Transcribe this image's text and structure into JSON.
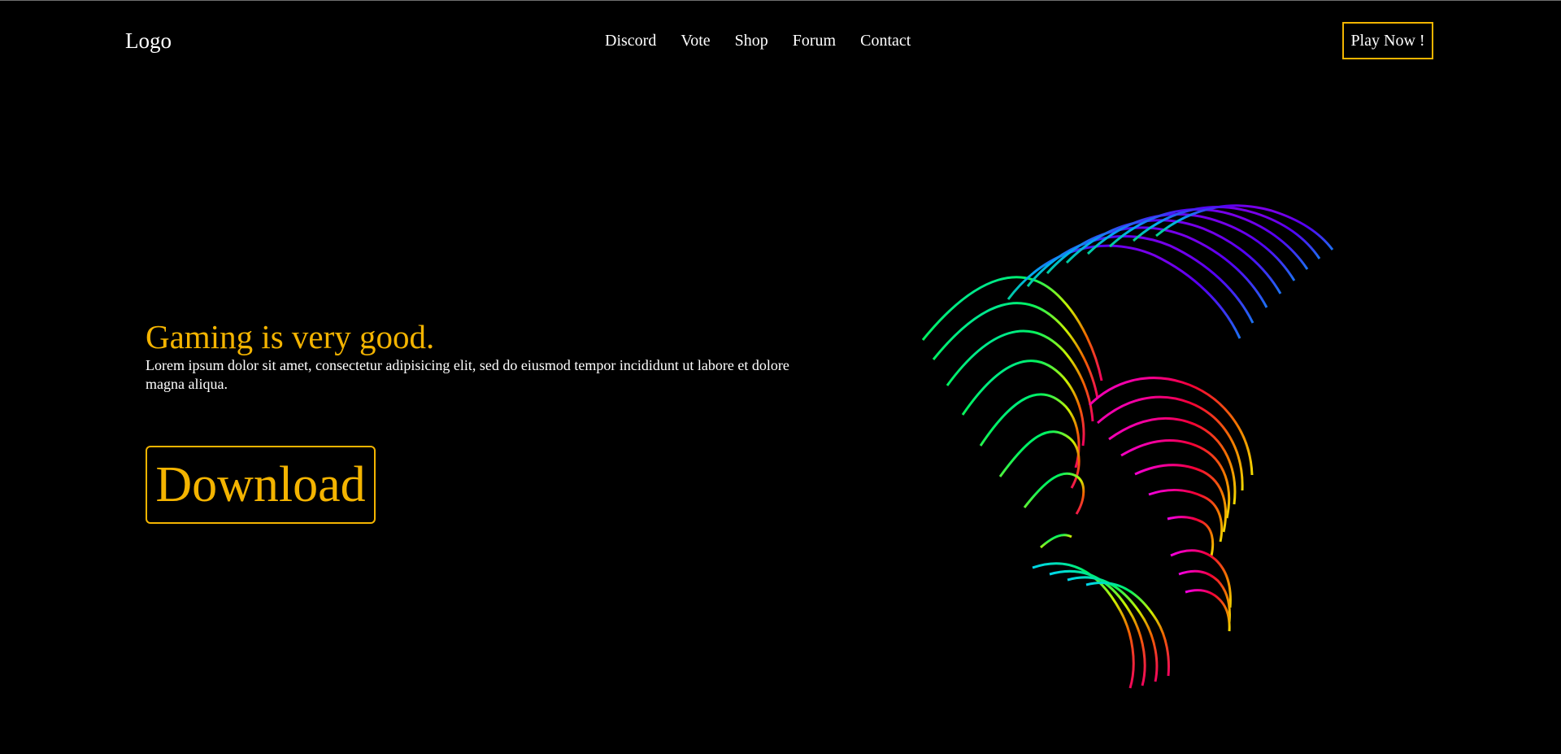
{
  "header": {
    "logo": "Logo",
    "nav": [
      "Discord",
      "Vote",
      "Shop",
      "Forum",
      "Contact"
    ],
    "cta": "Play Now !"
  },
  "hero": {
    "title": "Gaming is very good.",
    "text": "Lorem ipsum dolor sit amet, consectetur adipisicing elit, sed do eiusmod tempor incididunt ut labore et dolore magna aliqua.",
    "download": "Download"
  },
  "colors": {
    "accent": "#f4b400",
    "background": "#000000",
    "text": "#ffffff"
  },
  "icons": {
    "artwork": "rainbow-wave-art-icon"
  }
}
